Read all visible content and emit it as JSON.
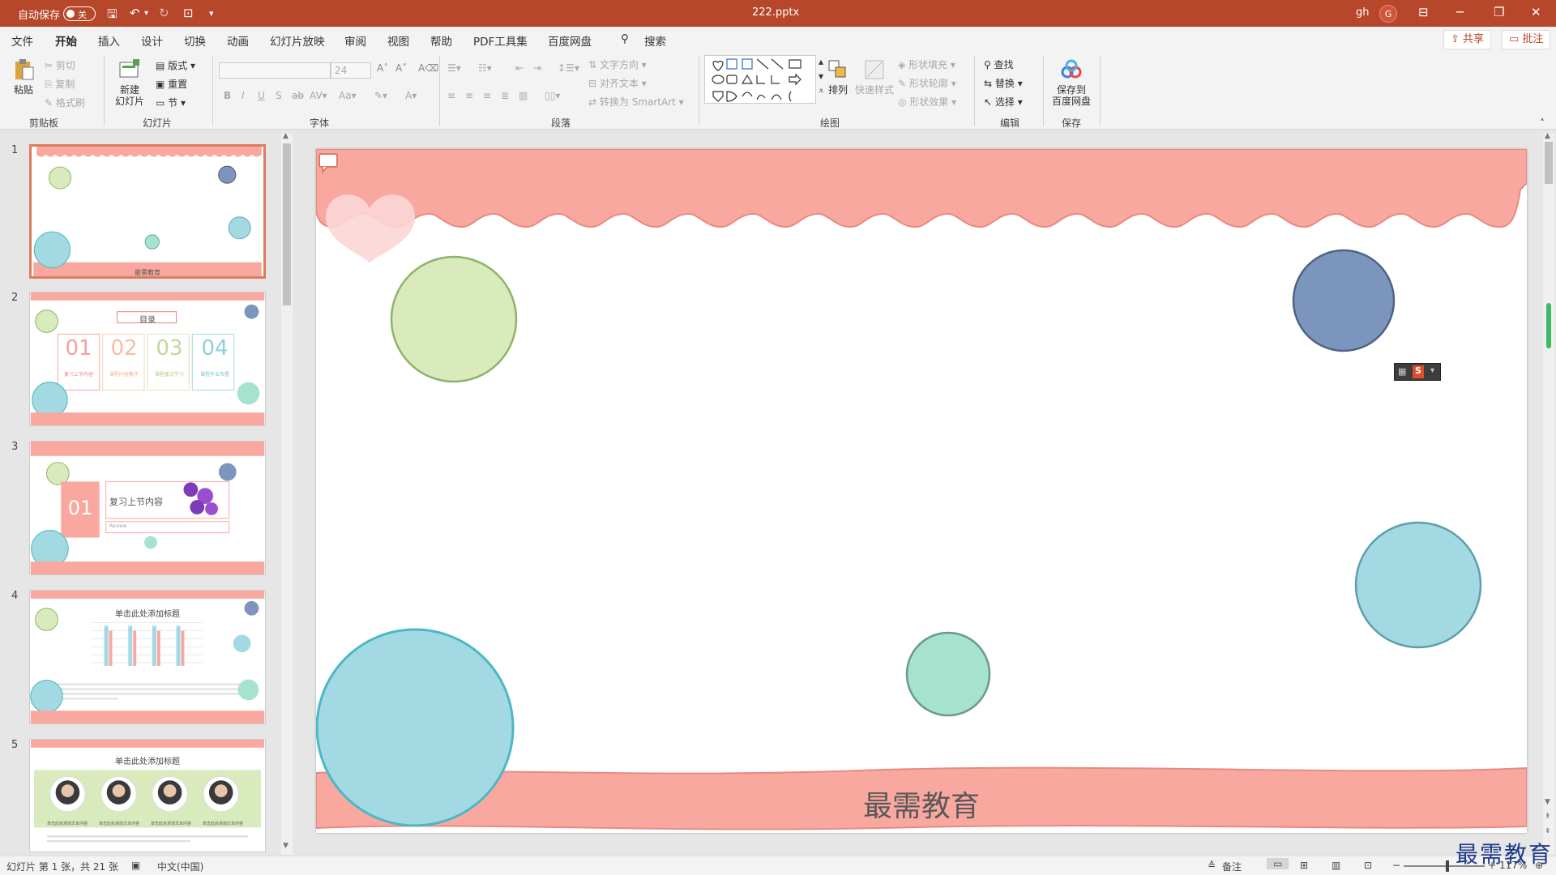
{
  "titlebar": {
    "autosave": "自动保存",
    "toggle_state": "关",
    "filename": "222.pptx",
    "user": "gh",
    "avatar_letter": "G",
    "accent": "#b7472a"
  },
  "menu": {
    "items": [
      "文件",
      "开始",
      "插入",
      "设计",
      "切换",
      "动画",
      "幻灯片放映",
      "审阅",
      "视图",
      "帮助",
      "PDF工具集",
      "百度网盘"
    ],
    "active": "开始",
    "search": "搜索",
    "share": "共享",
    "comment": "批注"
  },
  "ribbon": {
    "clipboard": {
      "paste": "粘贴",
      "cut": "剪切",
      "copy": "复制",
      "format_painter": "格式刷",
      "label": "剪贴板"
    },
    "slides": {
      "new": "新建",
      "new2": "幻灯片",
      "layout": "版式",
      "reset": "重置",
      "section": "节",
      "label": "幻灯片"
    },
    "font": {
      "size": "24",
      "label": "字体"
    },
    "paragraph": {
      "text_direction": "文字方向",
      "align_text": "对齐文本",
      "smartart": "转换为 SmartArt",
      "label": "段落"
    },
    "drawing": {
      "arrange": "排列",
      "quick_styles": "快速样式",
      "fill": "形状填充",
      "outline": "形状轮廓",
      "effect": "形状效果",
      "label": "绘图"
    },
    "editing": {
      "find": "查找",
      "replace": "替换",
      "select": "选择",
      "label": "编辑"
    },
    "save": {
      "btn1": "保存到",
      "btn2": "百度网盘",
      "label": "保存"
    }
  },
  "thumbnails": [
    {
      "num": "1",
      "caption": "最需教育"
    },
    {
      "num": "2",
      "title": "目录",
      "items": [
        "01",
        "02",
        "03",
        "04"
      ],
      "subs": [
        "复习上节内容",
        "课程内容教学",
        "课程重点学习",
        "课程作业布置"
      ]
    },
    {
      "num": "3",
      "num_label": "01",
      "title": "复习上节内容",
      "sub": "Review"
    },
    {
      "num": "4",
      "title": "单击此处添加标题"
    },
    {
      "num": "5",
      "title": "单击此处添加标题",
      "caption": "单击此处添加文本内容"
    }
  ],
  "slide": {
    "title": "最需教育",
    "colors": {
      "pink": "#f9a8a0",
      "green": "#d9eabc",
      "blue": "#7b95bd",
      "cyan": "#a3d9e3",
      "mint": "#a6e3cf"
    }
  },
  "status": {
    "slide_info": "幻灯片 第 1 张，共 21 张",
    "language": "中文(中国)",
    "notes": "备注",
    "zoom": "117%"
  },
  "watermark": "最需教育"
}
